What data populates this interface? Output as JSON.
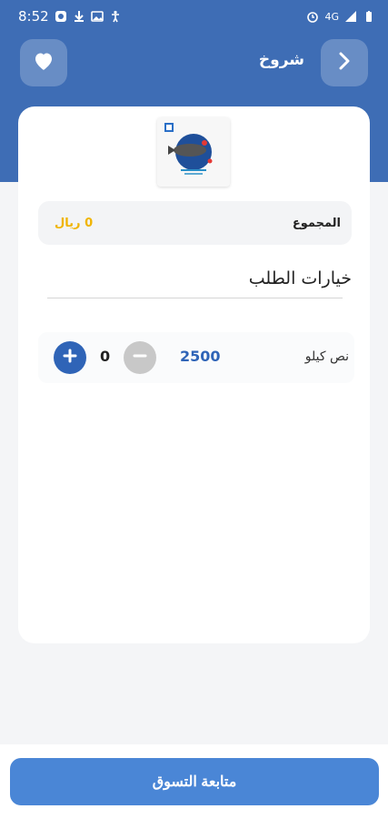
{
  "status_bar": {
    "time": "8:52",
    "network": "4G"
  },
  "nav": {
    "title": "شروخ",
    "back_icon": "chevron-right-icon",
    "favorite_icon": "heart-icon"
  },
  "summary": {
    "total_label": "المجموع",
    "total_value": "0 ريال"
  },
  "options": {
    "title": "خيارات الطلب",
    "items": [
      {
        "name": "نص كيلو",
        "price": "2500",
        "quantity": "0"
      }
    ]
  },
  "footer": {
    "continue_label": "متابعة التسوق"
  },
  "colors": {
    "header": "#3e6db5",
    "accent": "#2f64b7",
    "button": "#4a86d6",
    "price_highlight": "#f0b400"
  }
}
